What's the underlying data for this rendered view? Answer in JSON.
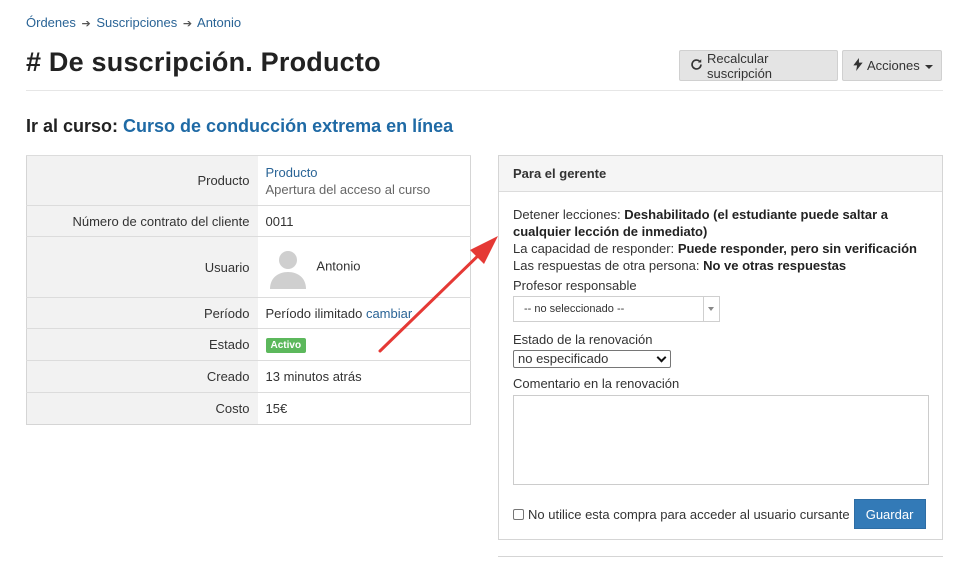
{
  "breadcrumb": {
    "items": [
      "Órdenes",
      "Suscripciones",
      "Antonio"
    ],
    "separator": "➔"
  },
  "header": {
    "title": "# De suscripción. Producto",
    "recalc_label": "Recalcular suscripción",
    "actions_label": "Acciones"
  },
  "course": {
    "prefix": "Ir al curso:",
    "link": "Curso de conducción extrema en línea"
  },
  "details": {
    "producto": {
      "label": "Producto",
      "value": "Producto",
      "sub": "Apertura del acceso al curso"
    },
    "contrato": {
      "label": "Número de contrato del cliente",
      "value": "0011"
    },
    "usuario": {
      "label": "Usuario",
      "value": "Antonio"
    },
    "periodo": {
      "label": "Período",
      "value": "Período ilimitado",
      "action": "cambiar"
    },
    "estado": {
      "label": "Estado",
      "value": "Activo"
    },
    "creado": {
      "label": "Creado",
      "value": "13 minutos atrás"
    },
    "costo": {
      "label": "Costo",
      "value": "15€"
    }
  },
  "manager_panel": {
    "title": "Para el gerente",
    "stop_lessons_label": "Detener lecciones:",
    "stop_lessons_value": "Deshabilitado (el estudiante puede saltar a cualquier lección de inmediato)",
    "answer_label": "La capacidad de responder:",
    "answer_value": "Puede responder, pero sin verificación",
    "others_label": "Las respuestas de otra persona:",
    "others_value": "No ve otras respuestas",
    "teacher_label": "Profesor responsable",
    "teacher_value": "-- no seleccionado --",
    "renewal_label": "Estado de la renovación",
    "renewal_value": "no especificado",
    "comment_label": "Comentario en la renovación",
    "comment_value": "",
    "checkbox_label": "No utilice esta compra para acceder al usuario cursante",
    "checkbox_checked": false,
    "save_label": "Guardar"
  },
  "colors": {
    "link": "#2a6496",
    "primary": "#337ab7",
    "success": "#5cb85c",
    "arrow": "#e53935"
  }
}
